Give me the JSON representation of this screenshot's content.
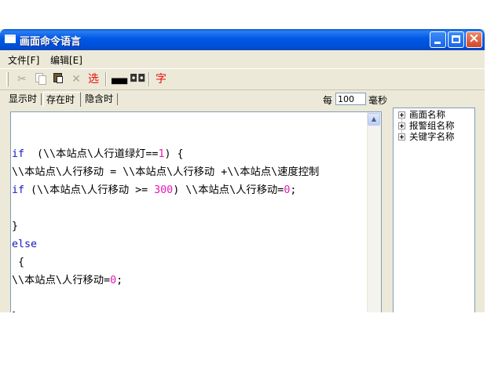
{
  "window": {
    "title": "画面命令语言"
  },
  "menu": {
    "file": "文件[F]",
    "edit": "编辑[E]"
  },
  "toolbar": {
    "cut_icon": "scissors-icon",
    "copy_icon": "copy-icon",
    "paste_icon": "paste-icon",
    "delete_glyph": "✕",
    "select_label": "选",
    "find_icon": "binoculars-icon",
    "replace_icon": "binoculars-replace-icon",
    "font_label": "字",
    "select_color": "#e81010",
    "font_color": "#e81010"
  },
  "tabs": [
    {
      "label": "显示时",
      "active": false
    },
    {
      "label": "存在时",
      "active": true
    },
    {
      "label": "隐含时",
      "active": false
    }
  ],
  "interval": {
    "prefix": "每",
    "value": "100",
    "unit": "毫秒"
  },
  "code": {
    "lines": [
      [
        {
          "t": "if",
          "c": "kw"
        },
        {
          "t": "  (\\\\本站点\\人行道绿灯=="
        },
        {
          "t": "1",
          "c": "num"
        },
        {
          "t": ") {"
        }
      ],
      [
        {
          "t": "\\\\本站点\\人行移动 = \\\\本站点\\人行移动 +\\\\本站点\\速度控制"
        }
      ],
      [
        {
          "t": "if",
          "c": "kw"
        },
        {
          "t": " (\\\\本站点\\人行移动 >= "
        },
        {
          "t": "300",
          "c": "num"
        },
        {
          "t": ") \\\\本站点\\人行移动="
        },
        {
          "t": "0",
          "c": "num"
        },
        {
          "t": ";"
        }
      ],
      [
        {
          "t": ""
        }
      ],
      [
        {
          "t": "}"
        }
      ],
      [
        {
          "t": "else",
          "c": "kw"
        }
      ],
      [
        {
          "t": " {"
        }
      ],
      [
        {
          "t": "\\\\本站点\\人行移动="
        },
        {
          "t": "0",
          "c": "num"
        },
        {
          "t": ";"
        }
      ],
      [
        {
          "t": ""
        }
      ],
      [
        {
          "t": "}"
        }
      ]
    ],
    "keyword_color": "#1818c8",
    "number_color": "#e818b8"
  },
  "tree": {
    "items": [
      {
        "label": "画面名称"
      },
      {
        "label": "报警组名称"
      },
      {
        "label": "关键字名称"
      }
    ]
  }
}
